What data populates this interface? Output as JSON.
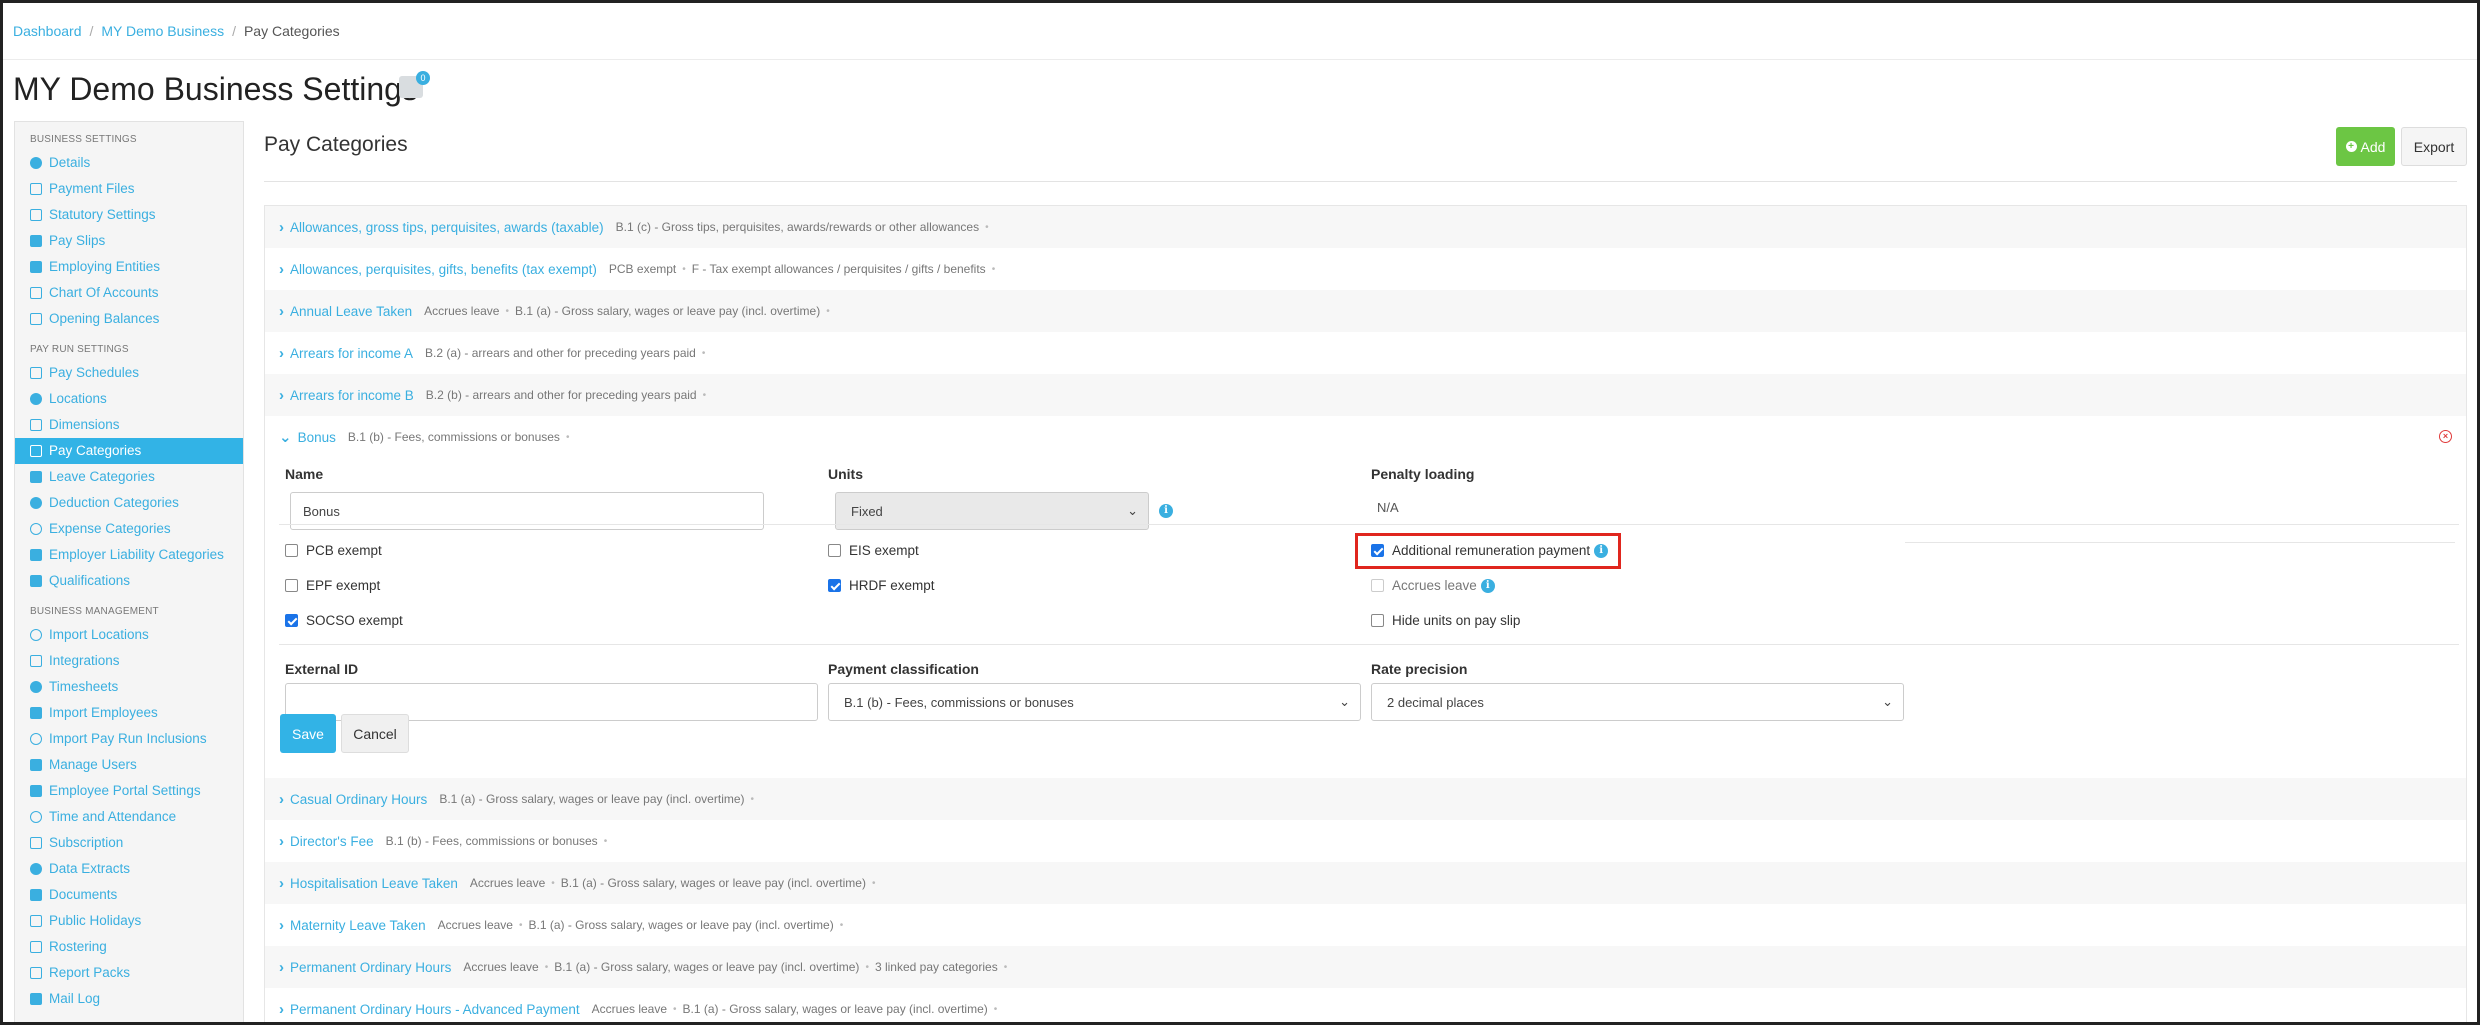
{
  "breadcrumb": {
    "items": [
      "Dashboard",
      "MY Demo Business"
    ],
    "current": "Pay Categories"
  },
  "page_title": "MY Demo Business Settings",
  "notification_count": "0",
  "sidebar": {
    "sections": [
      {
        "title": "BUSINESS SETTINGS",
        "items": [
          {
            "label": "Details",
            "icon": "gear-icon"
          },
          {
            "label": "Payment Files",
            "icon": "file-icon"
          },
          {
            "label": "Statutory Settings",
            "icon": "scale-icon"
          },
          {
            "label": "Pay Slips",
            "icon": "document-icon"
          },
          {
            "label": "Employing Entities",
            "icon": "bank-icon"
          },
          {
            "label": "Chart Of Accounts",
            "icon": "list-icon"
          },
          {
            "label": "Opening Balances",
            "icon": "book-icon"
          }
        ]
      },
      {
        "title": "PAY RUN SETTINGS",
        "items": [
          {
            "label": "Pay Schedules",
            "icon": "calendar-icon"
          },
          {
            "label": "Locations",
            "icon": "globe-icon"
          },
          {
            "label": "Dimensions",
            "icon": "dimensions-icon"
          },
          {
            "label": "Pay Categories",
            "icon": "money-icon",
            "active": true
          },
          {
            "label": "Leave Categories",
            "icon": "plane-icon"
          },
          {
            "label": "Deduction Categories",
            "icon": "minus-circle-icon"
          },
          {
            "label": "Expense Categories",
            "icon": "dollar-circle-icon"
          },
          {
            "label": "Employer Liability Categories",
            "icon": "bar-chart-icon"
          },
          {
            "label": "Qualifications",
            "icon": "check-icon"
          }
        ]
      },
      {
        "title": "BUSINESS MANAGEMENT",
        "items": [
          {
            "label": "Import Locations",
            "icon": "map-marker-icon"
          },
          {
            "label": "Integrations",
            "icon": "plug-icon"
          },
          {
            "label": "Timesheets",
            "icon": "clock-icon"
          },
          {
            "label": "Import Employees",
            "icon": "users-icon"
          },
          {
            "label": "Import Pay Run Inclusions",
            "icon": "refresh-icon"
          },
          {
            "label": "Manage Users",
            "icon": "lock-icon"
          },
          {
            "label": "Employee Portal Settings",
            "icon": "wrench-icon"
          },
          {
            "label": "Time and Attendance",
            "icon": "user-circle-icon"
          },
          {
            "label": "Subscription",
            "icon": "credit-card-icon"
          },
          {
            "label": "Data Extracts",
            "icon": "cloud-download-icon"
          },
          {
            "label": "Documents",
            "icon": "folder-icon"
          },
          {
            "label": "Public Holidays",
            "icon": "calendar-icon"
          },
          {
            "label": "Rostering",
            "icon": "calendar-grid-icon"
          },
          {
            "label": "Report Packs",
            "icon": "folder-open-icon"
          },
          {
            "label": "Mail Log",
            "icon": "envelope-icon"
          }
        ]
      }
    ]
  },
  "main": {
    "title": "Pay Categories",
    "add_label": "Add",
    "export_label": "Export"
  },
  "categories_before": [
    {
      "name": "Allowances, gross tips, perquisites, awards (taxable)",
      "meta": [
        "B.1 (c) - Gross tips, perquisites, awards/rewards or other allowances"
      ]
    },
    {
      "name": "Allowances, perquisites, gifts, benefits (tax exempt)",
      "meta": [
        "PCB exempt",
        "F - Tax exempt allowances / perquisites / gifts / benefits"
      ]
    },
    {
      "name": "Annual Leave Taken",
      "meta": [
        "Accrues leave",
        "B.1 (a) - Gross salary, wages or leave pay (incl. overtime)"
      ]
    },
    {
      "name": "Arrears for income A",
      "meta": [
        "B.2 (a) - arrears and other for preceding years paid"
      ]
    },
    {
      "name": "Arrears for income B",
      "meta": [
        "B.2 (b) - arrears and other for preceding years paid"
      ]
    }
  ],
  "expanded": {
    "name": "Bonus",
    "meta": "B.1 (b) - Fees, commissions or bonuses",
    "labels": {
      "name": "Name",
      "units": "Units",
      "penalty": "Penalty loading",
      "external_id": "External ID",
      "payment_classification": "Payment classification",
      "rate_precision": "Rate precision"
    },
    "name_value": "Bonus",
    "units_value": "Fixed",
    "penalty_value": "N/A",
    "external_id_value": "",
    "payment_classification_value": "B.1 (b) - Fees, commissions or bonuses",
    "rate_precision_value": "2 decimal places",
    "checkboxes": {
      "pcb_exempt": {
        "label": "PCB exempt",
        "checked": false
      },
      "epf_exempt": {
        "label": "EPF exempt",
        "checked": false
      },
      "socso_exempt": {
        "label": "SOCSO exempt",
        "checked": true
      },
      "eis_exempt": {
        "label": "EIS exempt",
        "checked": false
      },
      "hrdf_exempt": {
        "label": "HRDF exempt",
        "checked": true
      },
      "additional_remuneration": {
        "label": "Additional remuneration payment",
        "checked": true
      },
      "accrues_leave": {
        "label": "Accrues leave",
        "checked": false
      },
      "hide_units": {
        "label": "Hide units on pay slip",
        "checked": false
      }
    },
    "save_label": "Save",
    "cancel_label": "Cancel"
  },
  "categories_after": [
    {
      "name": "Casual Ordinary Hours",
      "meta": [
        "B.1 (a) - Gross salary, wages or leave pay (incl. overtime)"
      ]
    },
    {
      "name": "Director's Fee",
      "meta": [
        "B.1 (b) - Fees, commissions or bonuses"
      ]
    },
    {
      "name": "Hospitalisation Leave Taken",
      "meta": [
        "Accrues leave",
        "B.1 (a) - Gross salary, wages or leave pay (incl. overtime)"
      ]
    },
    {
      "name": "Maternity Leave Taken",
      "meta": [
        "Accrues leave",
        "B.1 (a) - Gross salary, wages or leave pay (incl. overtime)"
      ]
    },
    {
      "name": "Permanent Ordinary Hours",
      "meta": [
        "Accrues leave",
        "B.1 (a) - Gross salary, wages or leave pay (incl. overtime)",
        "3 linked pay categories"
      ]
    },
    {
      "name": "Permanent Ordinary Hours - Advanced Payment",
      "meta": [
        "Accrues leave",
        "B.1 (a) - Gross salary, wages or leave pay (incl. overtime)"
      ]
    }
  ],
  "colors": {
    "accent": "#3aafe0",
    "active_nav": "#32b3e6",
    "add_button": "#6cc644",
    "highlight_box": "#e0261e",
    "checkbox_checked": "#1a73e8"
  }
}
